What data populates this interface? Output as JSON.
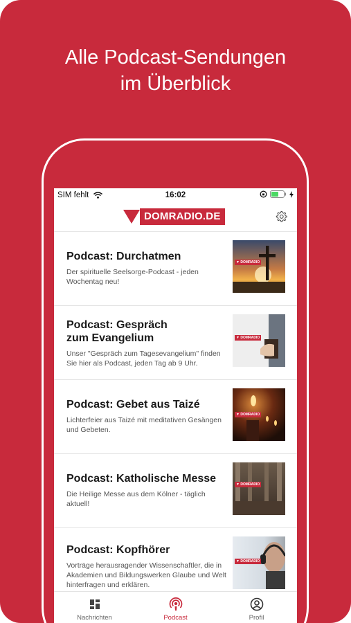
{
  "headline": {
    "line1": "Alle Podcast-Sendungen",
    "line2": "im Überblick"
  },
  "status": {
    "carrier": "SIM fehlt",
    "time": "16:02"
  },
  "brand": {
    "logo_text": "DOMRADIO.DE",
    "color": "#c82a3c"
  },
  "podcasts": [
    {
      "title": "Podcast: Durchatmen",
      "desc": "Der spirituelle Seelsorge-Podcast - jeden Wochentag neu!",
      "thumb": "sunset-cross"
    },
    {
      "title": "Podcast: Gespräch zum Evangelium",
      "desc": "Unser \"Gespräch zum Tagesevangelium\" finden Sie hier als Podcast, jeden Tag ab 9 Uhr.",
      "thumb": "bible-hands"
    },
    {
      "title": "Podcast: Gebet aus Taizé",
      "desc": "Lichterfeier aus Taizé mit meditativen Gesängen und Gebeten.",
      "thumb": "candles"
    },
    {
      "title": "Podcast: Katholische Messe",
      "desc": "Die Heilige Messe aus dem Kölner - täglich aktuell!",
      "thumb": "cathedral"
    },
    {
      "title": "Podcast: Kopfhörer",
      "desc": "Vorträge herausragender Wissenschaftler, die in Akademien und Bildungswerken Glaube und Welt hinterfragen und erklären.",
      "thumb": "headphones-man"
    }
  ],
  "tabs": [
    {
      "label": "Nachrichten",
      "icon": "news-icon",
      "active": false
    },
    {
      "label": "Podcast",
      "icon": "podcast-icon",
      "active": true
    },
    {
      "label": "Profil",
      "icon": "profile-icon",
      "active": false
    }
  ]
}
